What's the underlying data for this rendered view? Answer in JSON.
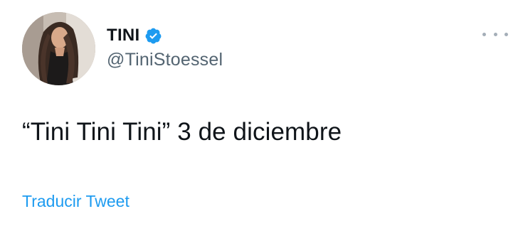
{
  "author": {
    "display_name": "TINI",
    "handle": "@TiniStoessel",
    "verified": true,
    "verified_color": "#1d9bf0",
    "avatar_icon": "profile-photo"
  },
  "menu": {
    "icon": "more-horizontal-icon"
  },
  "tweet": {
    "text": "“Tini Tini Tini” 3 de diciembre",
    "translate_label": "Traducir Tweet"
  },
  "colors": {
    "text_primary": "#0f1419",
    "text_secondary": "#536471",
    "link": "#1d9bf0"
  }
}
